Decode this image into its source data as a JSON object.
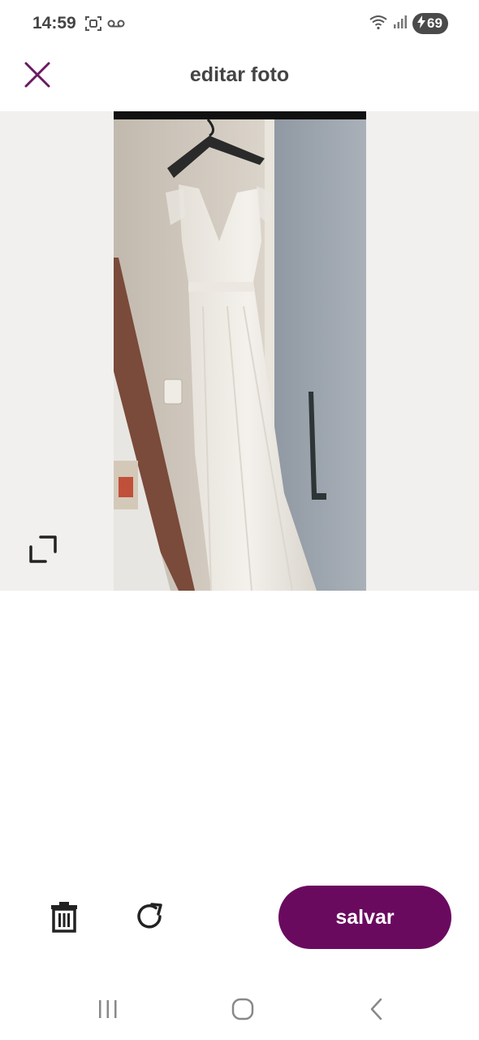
{
  "status_bar": {
    "time": "14:59",
    "left_icons": [
      "screen-record-icon",
      "voicemail-icon"
    ],
    "right_icons": [
      "wifi-icon",
      "signal-icon"
    ],
    "battery_level": "69",
    "battery_charging": true
  },
  "header": {
    "title": "editar foto",
    "close_icon": "close-icon",
    "accent_color": "#6a1b63"
  },
  "image_area": {
    "photo_subject": "white dress on hanger",
    "expand_icon": "expand-icon"
  },
  "toolbar": {
    "delete_icon": "trash-icon",
    "rotate_icon": "rotate-icon",
    "save_label": "salvar",
    "save_color": "#6a0a5f"
  },
  "navbar": {
    "recents_icon": "recents-icon",
    "home_icon": "home-icon",
    "back_icon": "back-icon"
  }
}
